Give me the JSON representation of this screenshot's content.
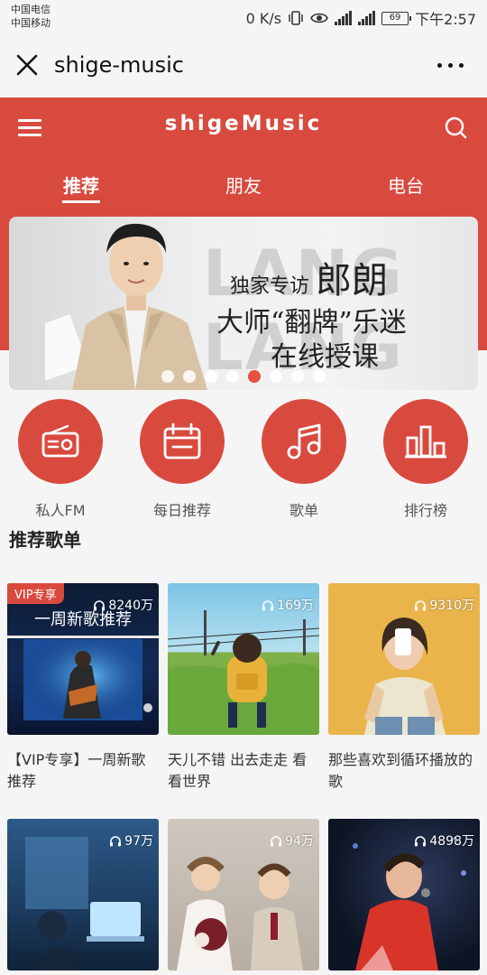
{
  "status_bar": {
    "carrier1": "中国电信",
    "carrier2": "中国移动",
    "speed": "0 K/s",
    "battery": "69",
    "time": "下午2:57"
  },
  "titlebar": {
    "title": "shige-music"
  },
  "header": {
    "app_title": "shigeMusic",
    "tabs": [
      {
        "label": "推荐",
        "active": true
      },
      {
        "label": "朋友",
        "active": false
      },
      {
        "label": "电台",
        "active": false
      }
    ]
  },
  "banner": {
    "bg_word": "LANG LANG",
    "line1_a": "独家专访",
    "line1_b": "郎朗",
    "line2": "大师“翻牌”乐迷",
    "line3": "在线授课",
    "dot_count": 8,
    "active_dot": 5
  },
  "features": [
    {
      "label": "私人FM",
      "icon": "radio-icon"
    },
    {
      "label": "每日推荐",
      "icon": "calendar-icon"
    },
    {
      "label": "歌单",
      "icon": "music-note-icon"
    },
    {
      "label": "排行榜",
      "icon": "chart-bars-icon"
    }
  ],
  "section_title": "推荐歌单",
  "playlists": [
    {
      "name": "【VIP专享】一周新歌推荐",
      "plays": "8240万",
      "badge": "VIP专享",
      "cover_text": "一周新歌推荐"
    },
    {
      "name": "天儿不错 出去走走 看看世界",
      "plays": "169万"
    },
    {
      "name": "那些喜欢到循环播放的歌",
      "plays": "9310万"
    },
    {
      "name": "",
      "plays": "97万"
    },
    {
      "name": "",
      "plays": "94万"
    },
    {
      "name": "",
      "plays": "4898万"
    }
  ],
  "colors": {
    "accent": "#d94a3e"
  }
}
